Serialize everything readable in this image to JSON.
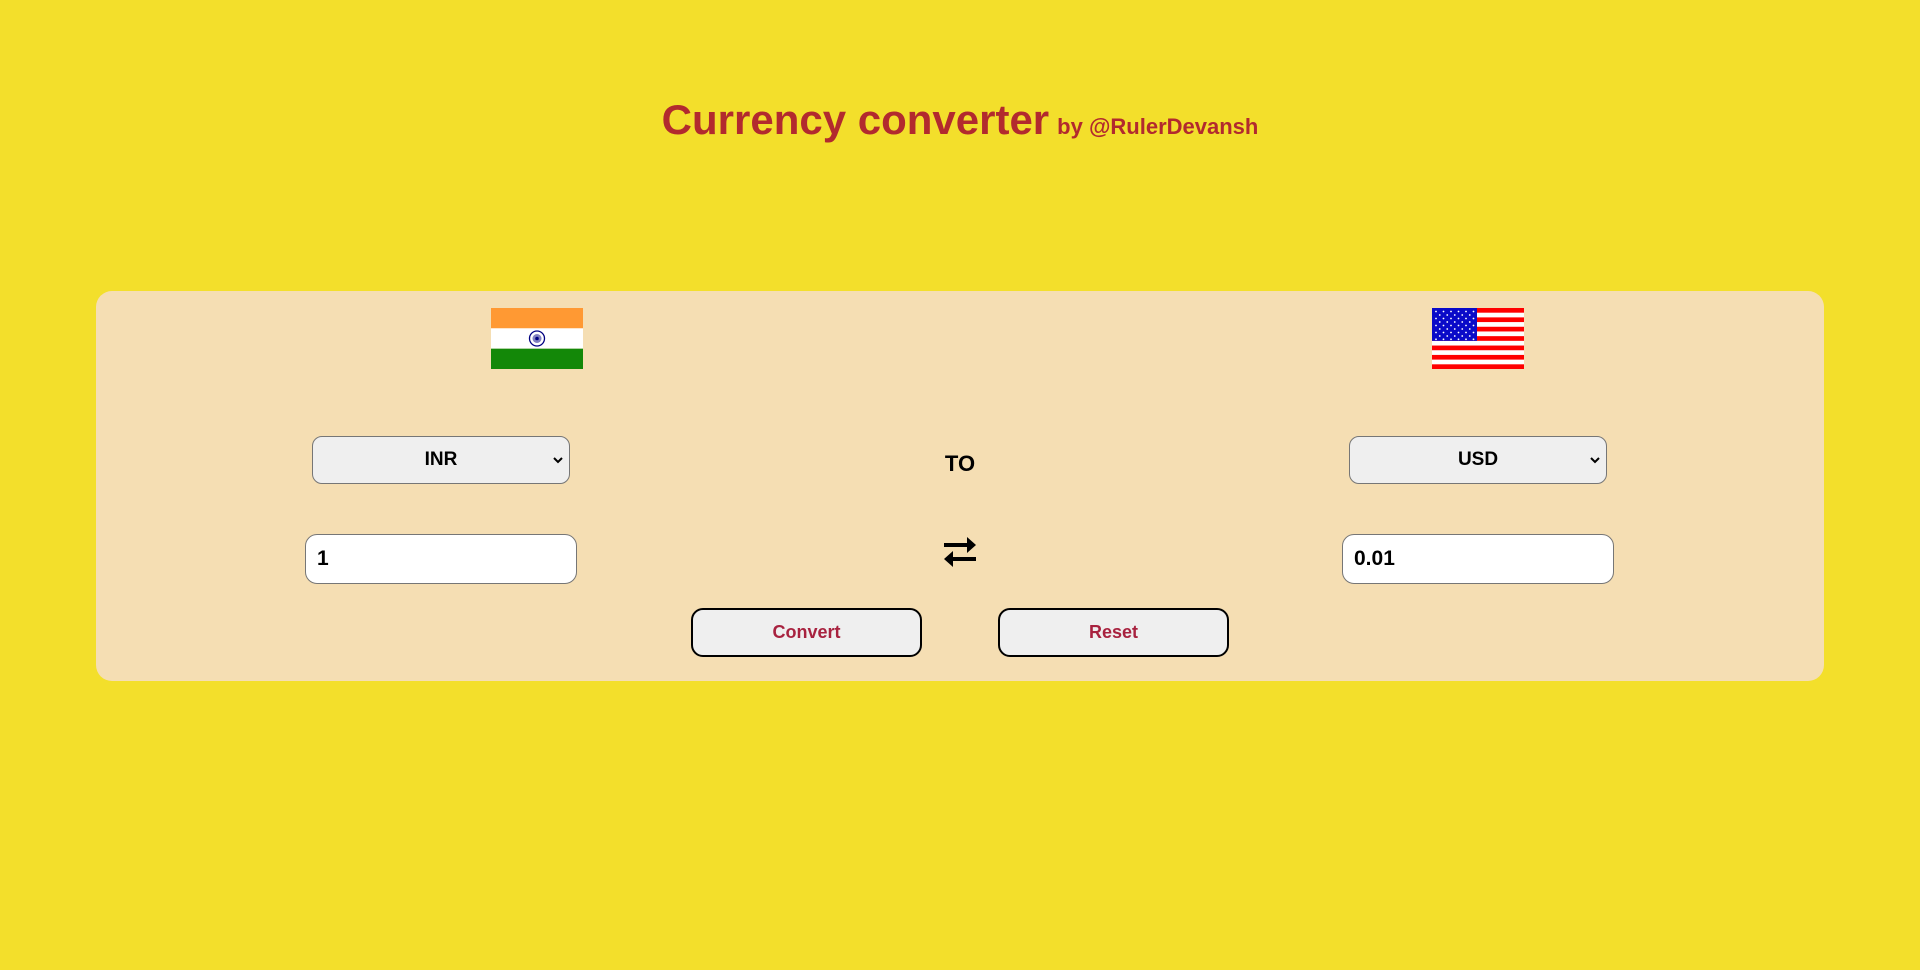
{
  "header": {
    "title": "Currency converter",
    "byline": "by @RulerDevansh"
  },
  "from": {
    "flag_icon": "india-flag-icon",
    "currency": "INR",
    "amount": "1"
  },
  "to": {
    "flag_icon": "usa-flag-icon",
    "currency": "USD",
    "amount": "0.01"
  },
  "middle": {
    "to_label": "TO",
    "swap_icon": "swap-arrows-icon"
  },
  "buttons": {
    "convert_label": "Convert",
    "reset_label": "Reset"
  },
  "colors": {
    "page_background": "#f3df2b",
    "card_background": "#f5deb3",
    "title_color": "#b22a2e",
    "button_text_color": "#a8223f"
  }
}
